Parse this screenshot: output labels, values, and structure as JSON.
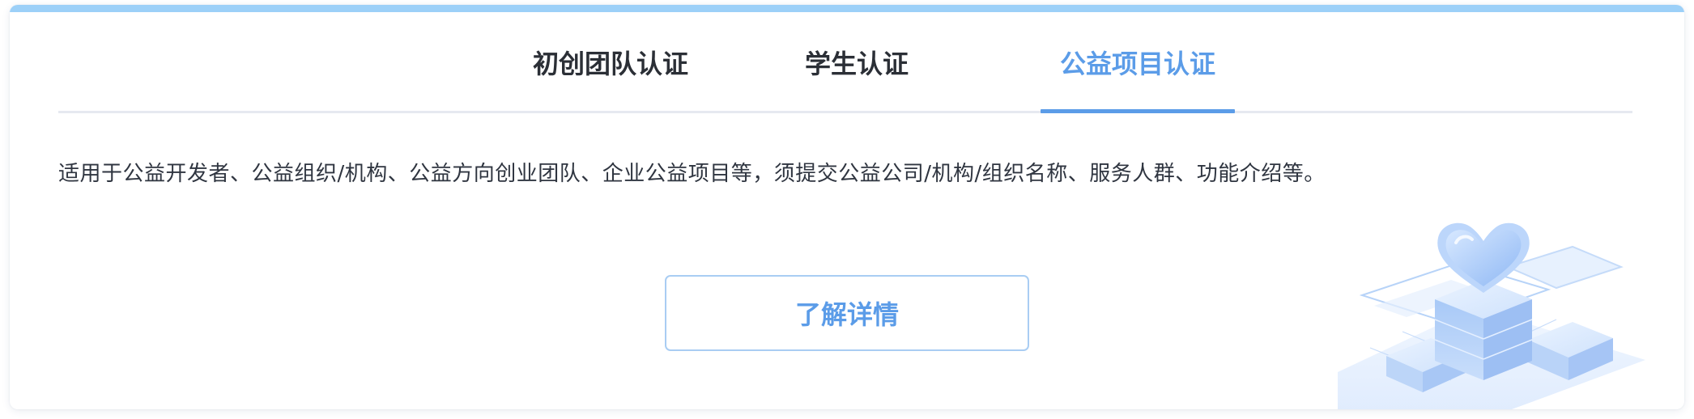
{
  "tabs": [
    {
      "label": "初创团队认证",
      "active": false
    },
    {
      "label": "学生认证",
      "active": false
    },
    {
      "label": "公益项目认证",
      "active": true
    }
  ],
  "description": "适用于公益开发者、公益组织/机构、公益方向创业团队、企业公益项目等，须提交公益公司/机构/组织名称、服务人群、功能介绍等。",
  "detail_button": {
    "label": "了解详情"
  },
  "illustration": {
    "icon": "heart-on-platform-illustration"
  },
  "colors": {
    "accent": "#5b9ce8",
    "top_stripe": "#9cd0f8",
    "text_primary": "#2b2f36",
    "divider": "#e6e9f0"
  }
}
